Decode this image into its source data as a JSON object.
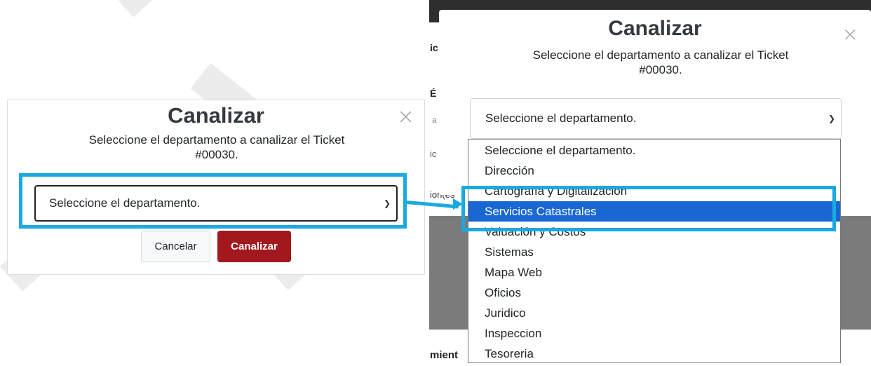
{
  "dialog": {
    "title": "Canalizar",
    "subtitle_line1": "Seleccione el departamento a canalizar el Ticket",
    "subtitle_line2": "#00030.",
    "close_symbol": "×",
    "select_placeholder": "Seleccione el departamento.",
    "cancel_label": "Cancelar",
    "submit_label": "Canalizar"
  },
  "dropdown": {
    "options": [
      "Seleccione el departamento.",
      "Dirección",
      "Cartografía y Digitalización",
      "Servicios Catastrales",
      "Valuación y Costos",
      "Sistemas",
      "Mapa Web",
      "Oficios",
      "Juridico",
      "Inspeccion",
      "Tesoreria"
    ],
    "selected": "Servicios Catastrales"
  },
  "background_page": {
    "fragments": [
      "ic",
      "É",
      "a",
      "ic",
      "ion(es",
      "mient"
    ]
  },
  "colors": {
    "highlight": "#1aa9e0",
    "submit_button": "#a3171f",
    "selected_option": "#1967d2"
  },
  "icons": [
    "close-icon",
    "chevron-down-icon",
    "arrow-connector"
  ]
}
